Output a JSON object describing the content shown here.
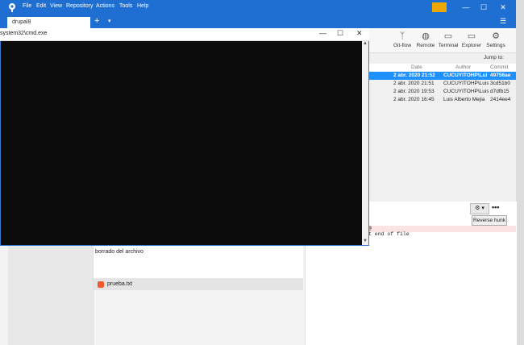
{
  "menu": [
    "File",
    "Edit",
    "View",
    "Repository",
    "Actions",
    "Tools",
    "Help"
  ],
  "tab": {
    "label": "drupal8",
    "add": "+",
    "dropdown": "▾"
  },
  "window_controls": {
    "minimize": "—",
    "maximize": "☐",
    "close": "✕"
  },
  "toolbar": [
    {
      "label": "Git-flow",
      "icon": "ᛉ"
    },
    {
      "label": "Remote",
      "icon": "◍"
    },
    {
      "label": "Terminal",
      "icon": "▭"
    },
    {
      "label": "Explorer",
      "icon": "▭"
    },
    {
      "label": "Settings",
      "icon": "⚙"
    }
  ],
  "jump_to": "Jump to:",
  "columns": {
    "date": "Date",
    "author": "Author",
    "commit": "Commit"
  },
  "commits": [
    {
      "date": "2 abr. 2020 21:52",
      "author": "CUCUYITOHP\\Lui",
      "hash": "49756ae",
      "selected": true
    },
    {
      "date": "2 abr. 2020 21:51",
      "author": "CUCUYITOHP\\Luis",
      "hash": "3cd51b0",
      "selected": false
    },
    {
      "date": "2 abr. 2020 19:53",
      "author": "CUCUYITOHP\\Luis",
      "hash": "d7dfb15",
      "selected": false
    },
    {
      "date": "2 abr. 2020 16:45",
      "author": "Luis Alberto Mejia",
      "hash": "2414ee4",
      "selected": false
    }
  ],
  "commit_message": "borrado del archivo",
  "file": "prueba.txt",
  "reverse_hunk": "Reverse hunk",
  "diff_lines": [
    "@",
    "t end of file"
  ],
  "cmd": {
    "title": "system32\\cmd.exe"
  },
  "colors": {
    "accent": "#1f6fd3",
    "selected_row": "#1e90ff",
    "file_icon": "#f05a2b",
    "flag": "#f0a800"
  }
}
